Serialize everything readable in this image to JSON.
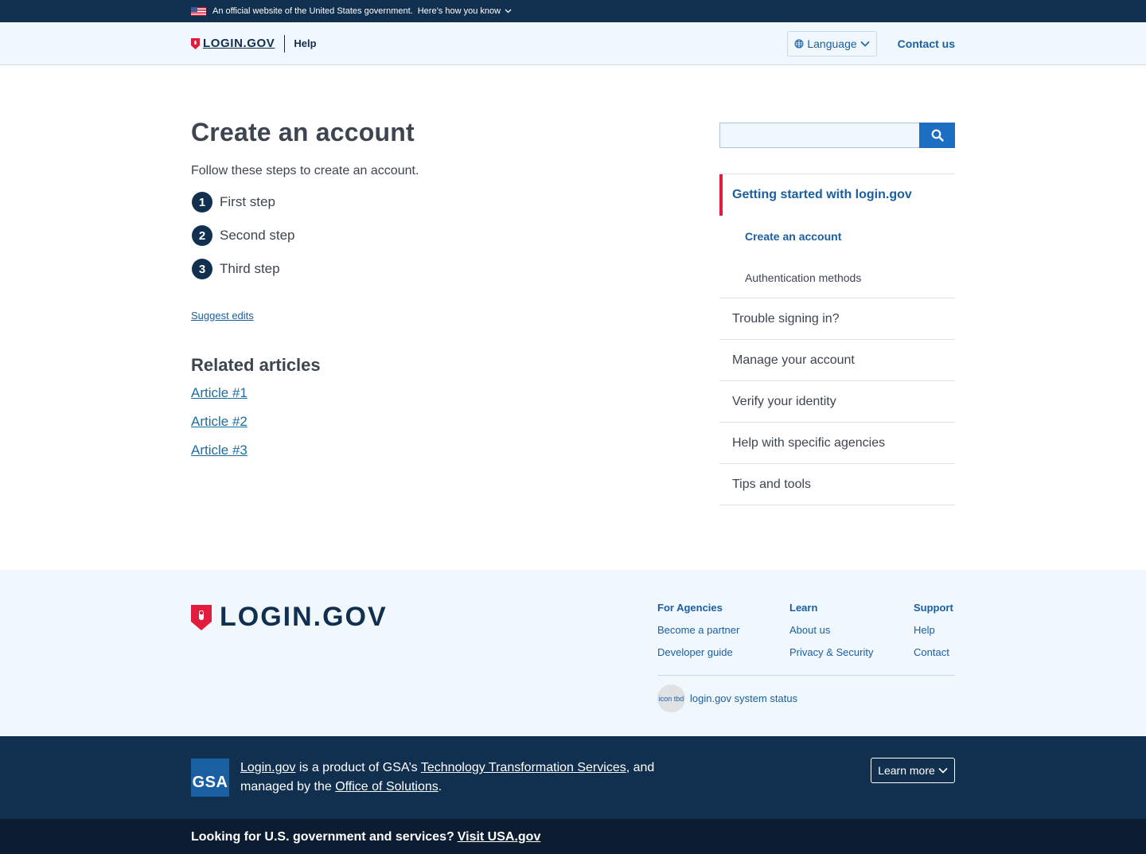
{
  "gov_banner": {
    "official_text": "An official website of the United States government.",
    "howto_text": "Here’s how you know"
  },
  "header": {
    "logo_text": "LOGIN.GOV",
    "help_label": "Help",
    "language_label": "Language",
    "contact_label": "Contact us"
  },
  "main": {
    "title": "Create an account",
    "intro": "Follow these steps to create an account.",
    "steps": [
      {
        "num": "1",
        "label": "First step"
      },
      {
        "num": "2",
        "label": "Second step"
      },
      {
        "num": "3",
        "label": "Third step"
      }
    ],
    "suggest_edits": "Suggest edits",
    "related_title": "Related articles",
    "related": [
      "Article #1",
      "Article #2",
      "Article #3"
    ]
  },
  "sidebar": {
    "search": {
      "value": "",
      "placeholder": ""
    },
    "current_section": "Getting started with login.gov",
    "sub_items": [
      "Create an account",
      "Authentication methods"
    ],
    "items": [
      "Trouble signing in?",
      "Manage your account",
      "Verify your identity",
      "Help with specific agencies",
      "Tips and tools"
    ]
  },
  "footer": {
    "logo_text": "LOGIN.GOV",
    "columns": [
      {
        "heading": "For Agencies",
        "links": [
          "Become a partner",
          "Developer guide"
        ]
      },
      {
        "heading": "Learn",
        "links": [
          "About us",
          "Privacy & Security"
        ]
      },
      {
        "heading": "Support",
        "links": [
          "Help",
          "Contact"
        ]
      }
    ],
    "status_icon_text": "icon tbd",
    "status_link": "login.gov system status"
  },
  "gsa": {
    "logo_text": "GSA",
    "product_link": "Login.gov",
    "text_1": " is a product of GSA’s ",
    "tts_link": "Technology Transformation Services",
    "text_2": ", and managed by the ",
    "office_link": "Office of Solutions",
    "text_3": ".",
    "learn_more": "Learn more"
  },
  "usa_bar": {
    "text": "Looking for U.S. government and services?",
    "link": "Visit USA.gov"
  },
  "colors": {
    "navy": "#112f4e",
    "link_blue": "#1b5fa3",
    "accent_red": "#e21c3d",
    "light_bg": "#f0f7fd",
    "search_button": "#1b6ec2"
  },
  "icons": [
    "us-flag-icon",
    "chevron-down-icon",
    "shield-logo-icon",
    "globe-icon",
    "search-icon"
  ]
}
